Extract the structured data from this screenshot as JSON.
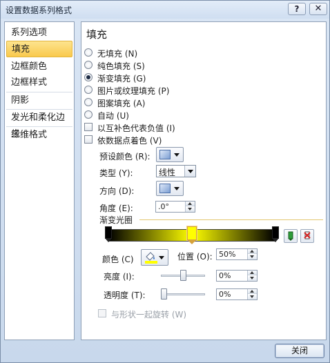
{
  "window": {
    "title": "设置数据系列格式",
    "help_label": "?",
    "close_label": "✕"
  },
  "sidebar": {
    "items": [
      {
        "label": "系列选项",
        "selected": false
      },
      {
        "label": "填充",
        "selected": true
      },
      {
        "label": "边框颜色",
        "selected": false
      },
      {
        "label": "边框样式",
        "selected": false
      },
      {
        "label": "阴影",
        "selected": false
      },
      {
        "label": "发光和柔化边缘",
        "selected": false
      },
      {
        "label": "三维格式",
        "selected": false
      }
    ]
  },
  "fill": {
    "title": "填充",
    "options": [
      {
        "label": "无填充 (N)",
        "checked": false
      },
      {
        "label": "纯色填充 (S)",
        "checked": false
      },
      {
        "label": "渐变填充 (G)",
        "checked": true
      },
      {
        "label": "图片或纹理填充 (P)",
        "checked": false
      },
      {
        "label": "图案填充 (A)",
        "checked": false
      },
      {
        "label": "自动 (U)",
        "checked": false
      }
    ],
    "invert_if_negative": {
      "label": "以互补色代表负值 (I)",
      "checked": false
    },
    "vary_colors_by_point": {
      "label": "依数据点着色 (V)",
      "checked": false
    },
    "preset_colors_label": "预设颜色 (R):",
    "type_label": "类型 (Y):",
    "type_value": "线性",
    "direction_label": "方向 (D):",
    "angle_label": "角度 (E):",
    "angle_value": ".0°",
    "gradient_stops_label": "渐变光圈",
    "stops": [
      {
        "position": 0,
        "color": "#000000",
        "selected": false
      },
      {
        "position": 50,
        "color": "#ffff00",
        "selected": true
      },
      {
        "position": 100,
        "color": "#000000",
        "selected": false
      }
    ],
    "add_stop_icon": "add-gradient-stop-icon",
    "remove_stop_icon": "remove-gradient-stop-icon",
    "color_label": "颜色 (C)",
    "color_value": "#ffff00",
    "position_label": "位置 (O):",
    "position_value": "50%",
    "brightness_label": "亮度 (I):",
    "brightness_value": "0%",
    "brightness_level": 0.5,
    "transparency_label": "透明度 (T):",
    "transparency_value": "0%",
    "transparency_level": 0,
    "rotate_with_shape": {
      "label": "与形状一起旋转 (W)",
      "checked": false,
      "enabled": false
    }
  },
  "footer": {
    "close_label": "关闭"
  },
  "colors": {
    "accent": "#f9c94c",
    "group_line": "#e3c76f"
  }
}
